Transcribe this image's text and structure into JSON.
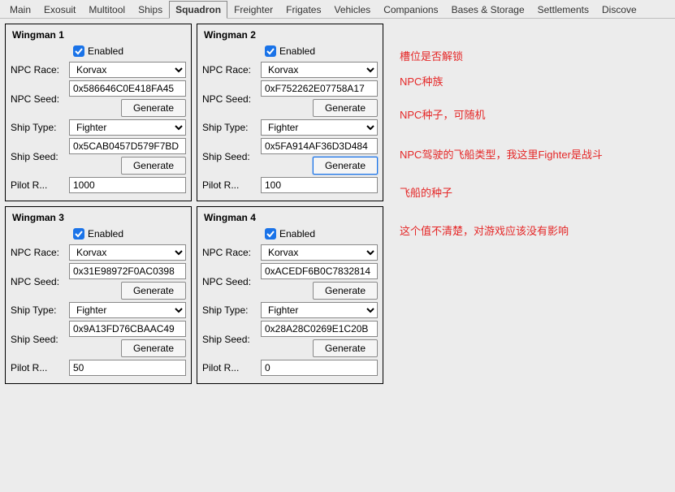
{
  "tabs": [
    "Main",
    "Exosuit",
    "Multitool",
    "Ships",
    "Squadron",
    "Freighter",
    "Frigates",
    "Vehicles",
    "Companions",
    "Bases & Storage",
    "Settlements",
    "Discove"
  ],
  "active_tab": "Squadron",
  "labels": {
    "enabled": "Enabled",
    "npc_race": "NPC Race:",
    "npc_seed": "NPC Seed:",
    "ship_type": "Ship Type:",
    "ship_seed": "Ship Seed:",
    "pilot_r": "Pilot R...",
    "generate": "Generate"
  },
  "race_options": [
    "Korvax"
  ],
  "type_options": [
    "Fighter"
  ],
  "wingmen": [
    {
      "title": "Wingman 1",
      "enabled": true,
      "race": "Korvax",
      "npc_seed": "0x586646C0E418FA45",
      "ship_type": "Fighter",
      "ship_seed": "0x5CAB0457D579F7BD",
      "pilot_r": "1000",
      "hl": false
    },
    {
      "title": "Wingman 2",
      "enabled": true,
      "race": "Korvax",
      "npc_seed": "0xF752262E07758A17",
      "ship_type": "Fighter",
      "ship_seed": "0x5FA914AF36D3D484",
      "pilot_r": "100",
      "hl": true
    },
    {
      "title": "Wingman 3",
      "enabled": true,
      "race": "Korvax",
      "npc_seed": "0x31E98972F0AC0398",
      "ship_type": "Fighter",
      "ship_seed": "0x9A13FD76CBAAC49",
      "pilot_r": "50",
      "hl": false
    },
    {
      "title": "Wingman 4",
      "enabled": true,
      "race": "Korvax",
      "npc_seed": "0xACEDF6B0C7832814",
      "ship_type": "Fighter",
      "ship_seed": "0x28A28C0269E1C20B",
      "pilot_r": "0",
      "hl": false
    }
  ],
  "annotations": {
    "a1": "槽位是否解锁",
    "a2": "NPC种族",
    "a3": "NPC种子，可随机",
    "a4": "NPC驾驶的飞船类型，我这里Fighter是战斗",
    "a5": "飞船的种子",
    "a6": "这个值不清楚，对游戏应该没有影响"
  }
}
